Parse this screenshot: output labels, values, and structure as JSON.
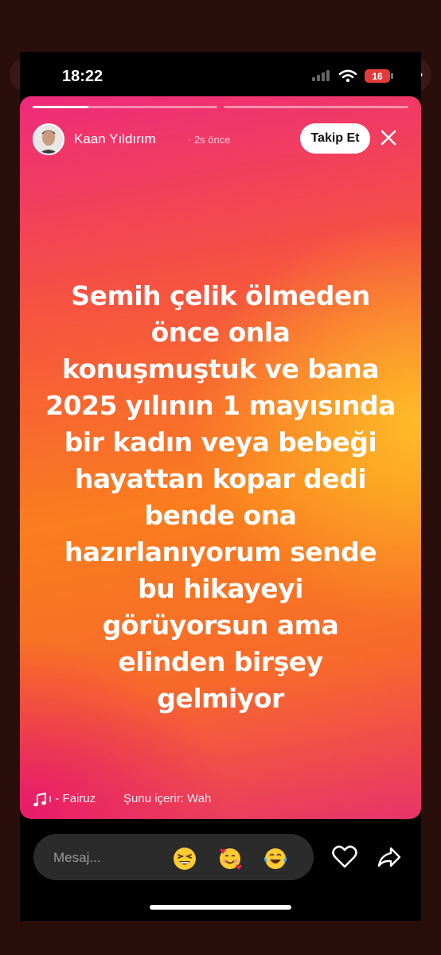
{
  "status_bar": {
    "time": "18:22",
    "battery": "16"
  },
  "story": {
    "progress": [
      0.3,
      0.0
    ],
    "user": {
      "name": "Kaan Yıldırım",
      "time_ago": "· 2s önce"
    },
    "follow_label": "Takip Et",
    "text_lines": [
      "Semih çelik ölmeden",
      "önce onla",
      "konuşmuştuk ve bana",
      "2025 yılının 1 mayısında",
      "bir kadın veya bebeği",
      "hayattan kopar dedi",
      "bende ona",
      "hazırlanıyorum sende",
      "bu hikayeyi",
      "görüyorsun ama",
      "elinden birşey",
      "gelmiyor"
    ],
    "music": "ı - Fairuz",
    "contains": "Şunu içerir: Wah"
  },
  "reply_bar": {
    "placeholder": "Mesaj...",
    "emojis": [
      "grinning-squinting-face",
      "smiling-face-with-hearts",
      "face-with-tears-of-joy"
    ]
  },
  "colors": {
    "gradient_top": "#ee2a7b",
    "gradient_mid": "#fa7d1e",
    "gradient_accent": "#ffc828"
  }
}
